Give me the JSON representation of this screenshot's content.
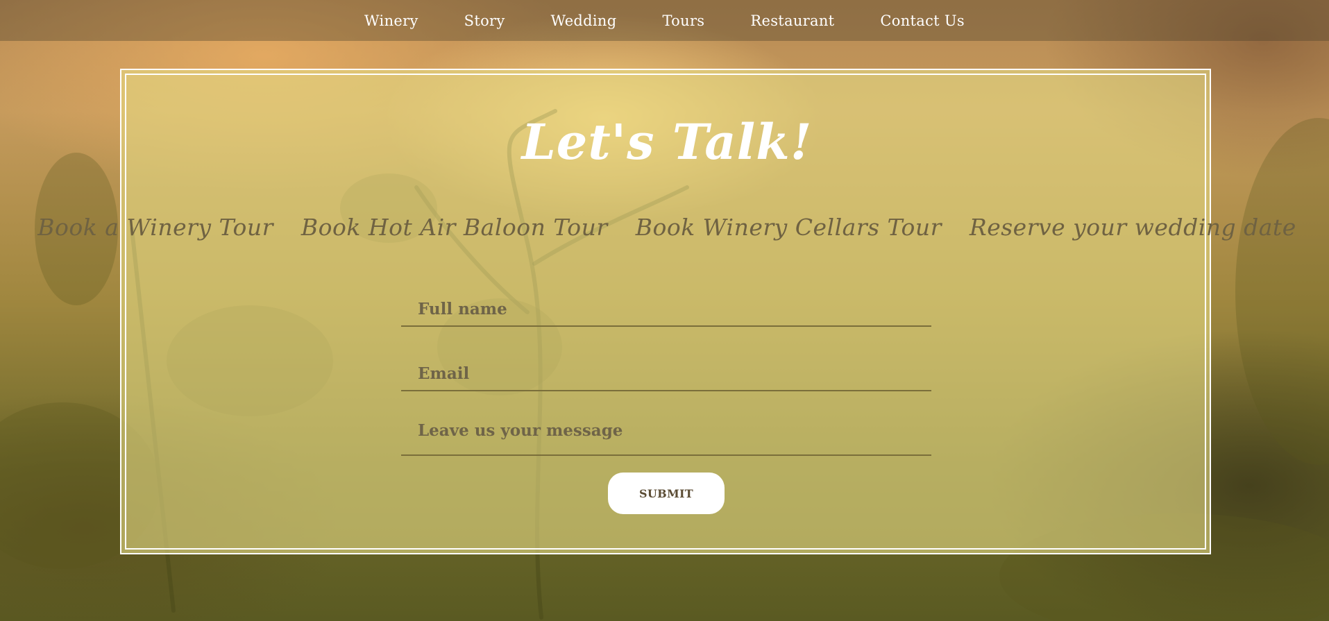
{
  "nav": {
    "items": [
      {
        "label": "Winery"
      },
      {
        "label": "Story"
      },
      {
        "label": "Wedding"
      },
      {
        "label": "Tours"
      },
      {
        "label": "Restaurant"
      },
      {
        "label": "Contact Us"
      }
    ]
  },
  "contact": {
    "title": "Let's Talk!",
    "booking_links": [
      {
        "label": "Book a Winery Tour"
      },
      {
        "label": "Book Hot Air Baloon Tour"
      },
      {
        "label": "Book Winery Cellars Tour"
      },
      {
        "label": "Reserve your wedding date"
      }
    ],
    "form": {
      "name_placeholder": "Full name",
      "email_placeholder": "Email",
      "message_placeholder": "Leave us your message",
      "submit_label": "SUBMIT"
    }
  },
  "colors": {
    "overlay": "#e4d882",
    "nav_bar": "#463c28",
    "booking_link_text": "#6f6242",
    "field_text": "#6a5e45",
    "field_underline": "#7a6e3a",
    "title_text": "#ffffff"
  }
}
